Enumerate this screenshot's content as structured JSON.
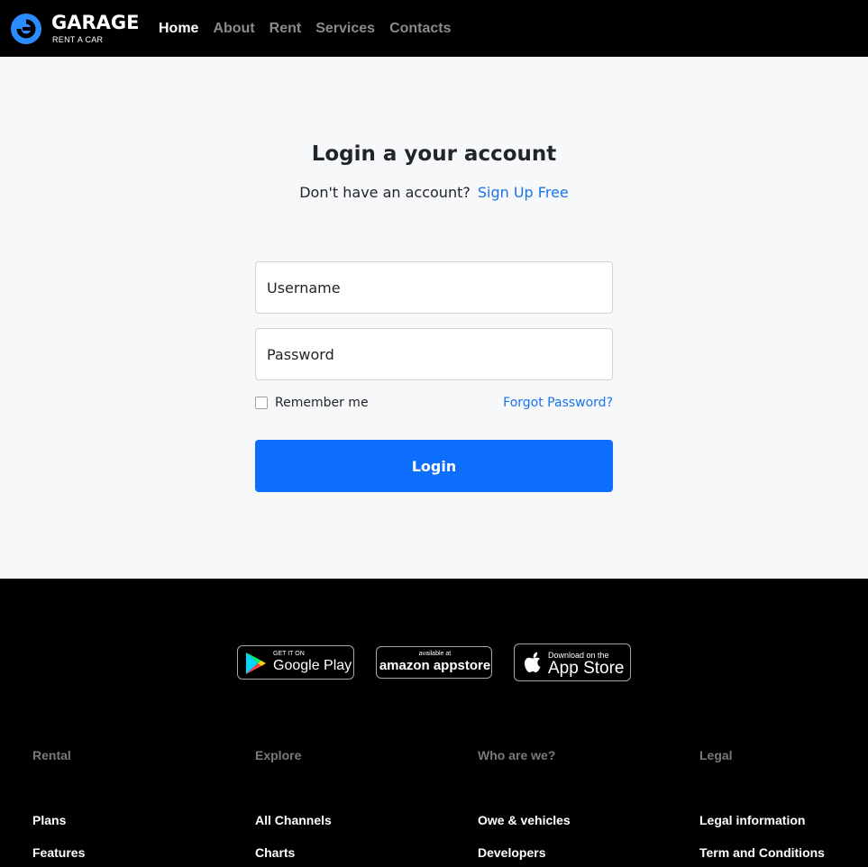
{
  "brand": {
    "name": "GARAGE",
    "tagline": "RENT A CAR",
    "accent": "#2b8cff"
  },
  "nav": [
    {
      "label": "Home",
      "active": true
    },
    {
      "label": "About",
      "active": false
    },
    {
      "label": "Rent",
      "active": false
    },
    {
      "label": "Services",
      "active": false
    },
    {
      "label": "Contacts",
      "active": false
    }
  ],
  "login": {
    "title": "Login a your account",
    "subtitle": "Don't have an account?",
    "signup_link": "Sign Up Free",
    "username_placeholder": "Username",
    "password_placeholder": "Password",
    "remember_label": "Remember me",
    "forgot_link": "Forgot Password?",
    "submit_label": "Login",
    "button_color": "#0d6efd",
    "link_color": "#1a73e8"
  },
  "stores": {
    "google": {
      "small": "GET IT ON",
      "big": "Google Play"
    },
    "amazon": {
      "small": "available at",
      "big": "amazon appstore"
    },
    "apple": {
      "small": "Download on the",
      "big": "App Store"
    }
  },
  "footer": {
    "columns": [
      {
        "heading": "Rental",
        "items": [
          "Plans",
          "Features"
        ]
      },
      {
        "heading": "Explore",
        "items": [
          "All Channels",
          "Charts"
        ]
      },
      {
        "heading": "Who are we?",
        "items": [
          "Owe & vehicles",
          "Developers"
        ]
      },
      {
        "heading": "Legal",
        "items": [
          "Legal information",
          "Term and Conditions"
        ]
      }
    ]
  }
}
